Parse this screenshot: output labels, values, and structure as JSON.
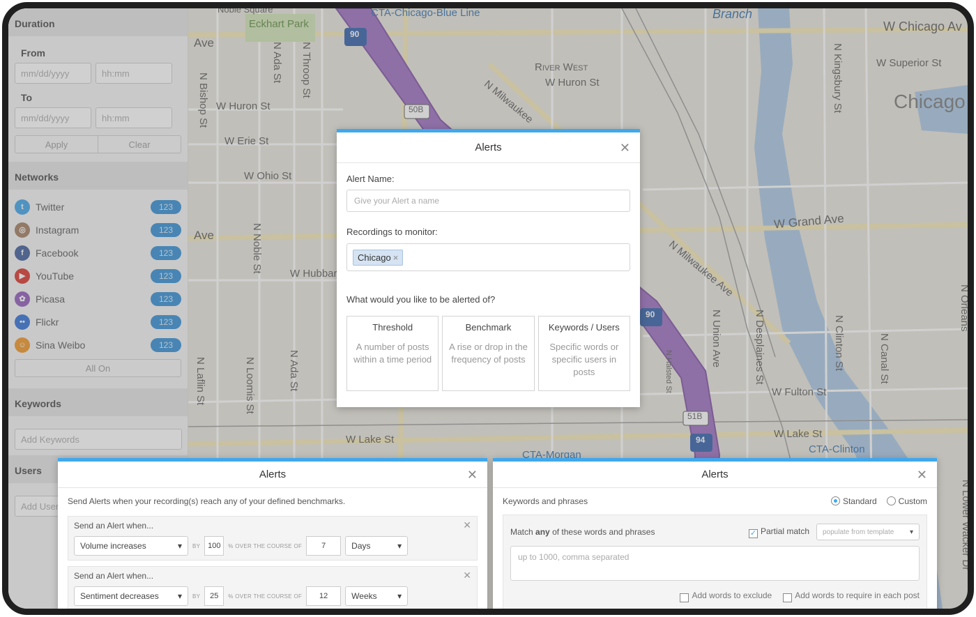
{
  "sidebar": {
    "duration_heading": "Duration",
    "from_label": "From",
    "to_label": "To",
    "date_placeholder": "mm/dd/yyyy",
    "time_placeholder": "hh:mm",
    "apply_label": "Apply",
    "clear_label": "Clear",
    "networks_heading": "Networks",
    "networks": [
      {
        "name": "Twitter",
        "count": "123",
        "color": "#3ba2e8",
        "icon": "twitter-icon"
      },
      {
        "name": "Instagram",
        "count": "123",
        "color": "#a07c5e",
        "icon": "instagram-icon"
      },
      {
        "name": "Facebook",
        "count": "123",
        "color": "#3b5998",
        "icon": "facebook-icon"
      },
      {
        "name": "YouTube",
        "count": "123",
        "color": "#d93025",
        "icon": "youtube-icon"
      },
      {
        "name": "Picasa",
        "count": "123",
        "color": "#8e56b8",
        "icon": "picasa-icon"
      },
      {
        "name": "Flickr",
        "count": "123",
        "color": "#2c6ed6",
        "icon": "flickr-icon"
      },
      {
        "name": "Sina Weibo",
        "count": "123",
        "color": "#f0931e",
        "icon": "weibo-icon"
      }
    ],
    "all_on_label": "All On",
    "keywords_heading": "Keywords",
    "keywords_placeholder": "Add Keywords",
    "users_heading": "Users",
    "users_placeholder": "Add Users"
  },
  "map_labels": {
    "eckhart_park": "Eckhart Park",
    "north_square": "Noble Square",
    "blue_line": "CTA-Chicago-Blue Line",
    "branch": "Branch",
    "w_chicago": "W Chicago Av",
    "w_superior": "W Superior St",
    "chicago": "Chicago",
    "river_west": "River West",
    "w_huron_1": "W Huron St",
    "w_huron_2": "W Huron St",
    "w_erie": "W Erie St",
    "w_ohio": "W Ohio St",
    "w_grand": "W Grand Ave",
    "n_milwaukee_1": "N Milwaukee",
    "n_milwaukee_2": "N Milwaukee Ave",
    "w_hubbard": "W Hubbard",
    "w_fulton": "W Fulton St",
    "w_lake_1": "W Lake St",
    "w_lake_2": "W Lake St",
    "cta_morgan": "CTA-Morgan",
    "cta_clinton": "CTA-Clinton",
    "ave_1": "Ave",
    "ave_2": "Ave",
    "n_ada_1": "N Ada St",
    "n_throop": "N Throop St",
    "n_bishop": "N Bishop St",
    "n_noble": "N Noble St",
    "n_laflin": "N Laflin St",
    "n_loomis": "N Loomis St",
    "n_ada_2": "N Ada St",
    "n_halsted": "N Halsted St",
    "n_union": "N Union Ave",
    "n_desplaines": "N Desplaines St",
    "n_clinton": "N Clinton St",
    "n_canal": "N Canal St",
    "n_kingsbury": "N Kingsbury St",
    "n_orleans": "N Orleans",
    "n_lower_wacker": "N Lower Wacker Dr",
    "hwy_90_a": "90",
    "hwy_90_b": "90",
    "hwy_94": "94",
    "exit_50b": "50B",
    "exit_51b": "51B"
  },
  "alert_dialog": {
    "title": "Alerts",
    "name_label": "Alert Name:",
    "name_placeholder": "Give your Alert a name",
    "recordings_label": "Recordings to monitor:",
    "recording_tag": "Chicago",
    "question": "What would you like to be alerted of?",
    "choices": [
      {
        "title": "Threshold",
        "desc": "A number of posts within a time period"
      },
      {
        "title": "Benchmark",
        "desc": "A rise or drop in the frequency of posts"
      },
      {
        "title": "Keywords / Users",
        "desc": "Specific words or specific users in posts"
      }
    ]
  },
  "benchmark_dialog": {
    "title": "Alerts",
    "intro": "Send Alerts when your recording(s) reach any of your defined benchmarks.",
    "rules": [
      {
        "heading": "Send an Alert when...",
        "metric": "Volume increases",
        "by": "BY",
        "value": "100",
        "over": "% OVER THE COURSE OF",
        "period": "7",
        "unit": "Days"
      },
      {
        "heading": "Send an Alert when...",
        "metric": "Sentiment decreases",
        "by": "BY",
        "value": "25",
        "over": "% OVER THE COURSE OF",
        "period": "12",
        "unit": "Weeks"
      }
    ]
  },
  "keywords_dialog": {
    "title": "Alerts",
    "section_label": "Keywords and phrases",
    "mode_standard": "Standard",
    "mode_custom": "Custom",
    "match_prefix": "Match",
    "match_any": "any",
    "match_suffix": "of these words and phrases",
    "partial_match": "Partial match",
    "template_placeholder": "populate from template",
    "textarea_placeholder": "up to 1000, comma separated",
    "exclude_label": "Add words to exclude",
    "require_label": "Add words to require in each post"
  }
}
